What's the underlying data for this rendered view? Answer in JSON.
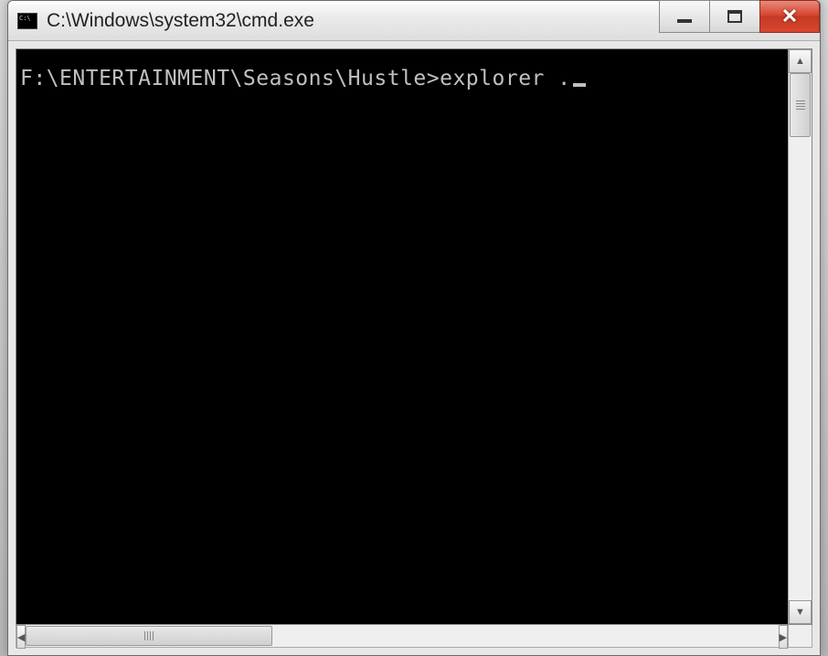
{
  "window": {
    "title": "C:\\Windows\\system32\\cmd.exe"
  },
  "terminal": {
    "prompt": "F:\\ENTERTAINMENT\\Seasons\\Hustle>",
    "command": "explorer ."
  }
}
